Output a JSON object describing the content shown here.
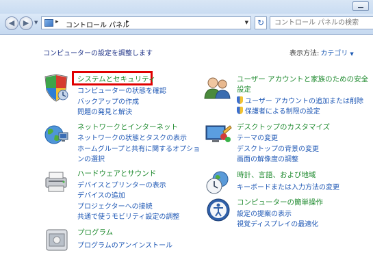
{
  "nav": {
    "back": "◀",
    "forward": "▶",
    "address_sep": "▸",
    "address_text": "コントロール パネル",
    "address_sep2": "▸",
    "dropdown": "▼",
    "refresh": "↻",
    "search_placeholder": "コントロール パネルの検索"
  },
  "main": {
    "heading": "コンピューターの設定を調整します",
    "view_label": "表示方法:",
    "view_value": "カテゴリ",
    "view_arrow": "▼"
  },
  "categories": [
    {
      "title": "システムとセキュリティ",
      "links": [
        "コンピューターの状態を確認",
        "バックアップの作成",
        "問題の発見と解決"
      ]
    },
    {
      "title": "ネットワークとインターネット",
      "links": [
        "ネットワークの状態とタスクの表示",
        "ホームグループと共有に関するオプショ",
        "ンの選択"
      ]
    },
    {
      "title": "ハードウェアとサウンド",
      "links": [
        "デバイスとプリンターの表示",
        "デバイスの追加",
        "プロジェクターへの接続",
        "共通で使うモビリティ設定の調整"
      ]
    },
    {
      "title": "プログラム",
      "links": [
        "プログラムのアンインストール"
      ]
    },
    {
      "title_line1": "ユーザー アカウントと家族のための安全",
      "title_line2": "設定",
      "links": [
        "ユーザー アカウントの追加または削除",
        "保護者による制限の設定"
      ]
    },
    {
      "title": "デスクトップのカスタマイズ",
      "links": [
        "テーマの変更",
        "デスクトップの背景の変更",
        "画面の解像度の調整"
      ]
    },
    {
      "title": "時計、言語、および地域",
      "links": [
        "キーボードまたは入力方法の変更"
      ]
    },
    {
      "title": "コンピューターの簡単操作",
      "links": [
        "設定の提案の表示",
        "視覚ディスプレイの最適化"
      ]
    }
  ],
  "colors": {
    "title": "#1e8a2e",
    "link": "#1f58b5",
    "highlight": "#e00000"
  }
}
